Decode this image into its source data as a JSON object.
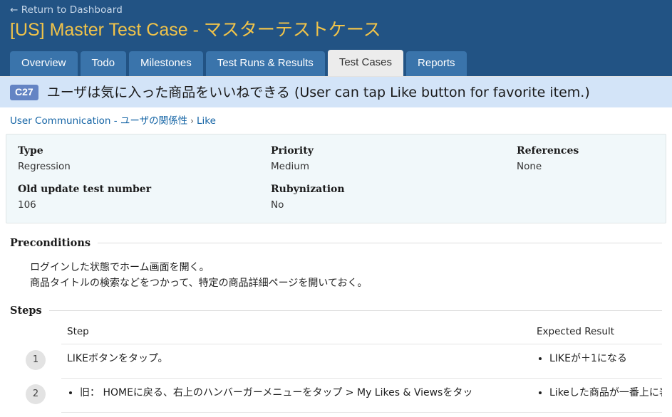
{
  "header": {
    "return_link": "← Return to Dashboard",
    "page_title": "[US] Master Test Case - マスターテストケース",
    "title_color": "#f0c34a",
    "background_color": "#225384",
    "tabs": [
      {
        "label": "Overview",
        "active": false
      },
      {
        "label": "Todo",
        "active": false
      },
      {
        "label": "Milestones",
        "active": false
      },
      {
        "label": "Test Runs & Results",
        "active": false
      },
      {
        "label": "Test Cases",
        "active": true
      },
      {
        "label": "Reports",
        "active": false
      }
    ]
  },
  "case_banner": {
    "badge": "C27",
    "badge_color": "#6484c4",
    "background_color": "#d3e4f8",
    "title": "ユーザは気に入った商品をいいねできる (User can tap Like button for favorite item.)"
  },
  "breadcrumb": {
    "parent": "User Communication - ユーザの関係性",
    "separator": "›",
    "current": "Like",
    "link_color": "#1464a5"
  },
  "meta": {
    "background_color": "#f1f8fa",
    "fields": [
      {
        "label": "Type",
        "value": "Regression"
      },
      {
        "label": "Priority",
        "value": "Medium"
      },
      {
        "label": "References",
        "value": "None"
      },
      {
        "label": "Old update test number",
        "value": "106"
      },
      {
        "label": "Rubynization",
        "value": "No"
      },
      {
        "label": "",
        "value": ""
      }
    ]
  },
  "preconditions": {
    "heading": "Preconditions",
    "lines": [
      "ログインした状態でホーム画面を開く。",
      "商品タイトルの検索などをつかって、特定の商品詳細ページを開いておく。"
    ]
  },
  "steps": {
    "heading": "Steps",
    "columns": {
      "number": "",
      "step": "Step",
      "expected": "Expected Result"
    },
    "rows": [
      {
        "number": "1",
        "step_lines": [
          "LIKEボタンをタップ。"
        ],
        "step_is_list": false,
        "expected_lines": [
          "LIKEが＋1になる"
        ],
        "expected_is_list": true
      },
      {
        "number": "2",
        "step_lines": [
          "旧： HOMEに戻る、右上のハンバーガーメニューをタップ > My Likes & Viewsをタッ"
        ],
        "step_is_list": true,
        "expected_lines": [
          "Likeした商品が一番上に表"
        ],
        "expected_is_list": true
      }
    ]
  }
}
